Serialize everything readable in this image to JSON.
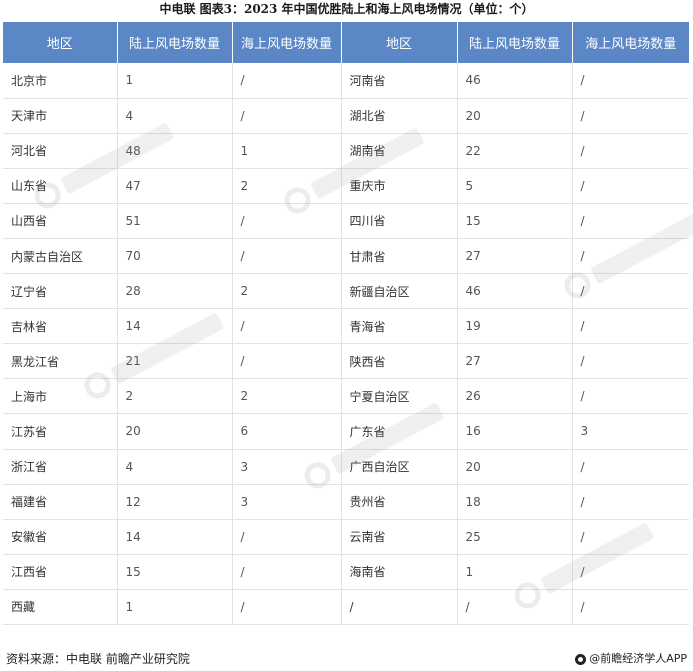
{
  "title": "中电联  图表3：2023 年中国优胜陆上和海上风电场情况（单位：个）",
  "table": {
    "headers": [
      "地区",
      "陆上风电场数量",
      "海上风电场数量",
      "地区",
      "陆上风电场数量",
      "海上风电场数量"
    ],
    "rows": [
      [
        "北京市",
        "1",
        "/",
        "河南省",
        "46",
        "/"
      ],
      [
        "天津市",
        "4",
        "/",
        "湖北省",
        "20",
        "/"
      ],
      [
        "河北省",
        "48",
        "1",
        "湖南省",
        "22",
        "/"
      ],
      [
        "山东省",
        "47",
        "2",
        "重庆市",
        "5",
        "/"
      ],
      [
        "山西省",
        "51",
        "/",
        "四川省",
        "15",
        "/"
      ],
      [
        "内蒙古自治区",
        "70",
        "/",
        "甘肃省",
        "27",
        "/"
      ],
      [
        "辽宁省",
        "28",
        "2",
        "新疆自治区",
        "46",
        "/"
      ],
      [
        "吉林省",
        "14",
        "/",
        "青海省",
        "19",
        "/"
      ],
      [
        "黑龙江省",
        "21",
        "/",
        "陕西省",
        "27",
        "/"
      ],
      [
        "上海市",
        "2",
        "2",
        "宁夏自治区",
        "26",
        "/"
      ],
      [
        "江苏省",
        "20",
        "6",
        "广东省",
        "16",
        "3"
      ],
      [
        "浙江省",
        "4",
        "3",
        "广西自治区",
        "20",
        "/"
      ],
      [
        "福建省",
        "12",
        "3",
        "贵州省",
        "18",
        "/"
      ],
      [
        "安徽省",
        "14",
        "/",
        "云南省",
        "25",
        "/"
      ],
      [
        "江西省",
        "15",
        "/",
        "海南省",
        "1",
        "/"
      ],
      [
        "西藏",
        "1",
        "/",
        "/",
        "/",
        "/"
      ]
    ]
  },
  "footer": {
    "source": "资料来源：中电联 前瞻产业研究院",
    "brand": "@前瞻经济学人APP"
  }
}
